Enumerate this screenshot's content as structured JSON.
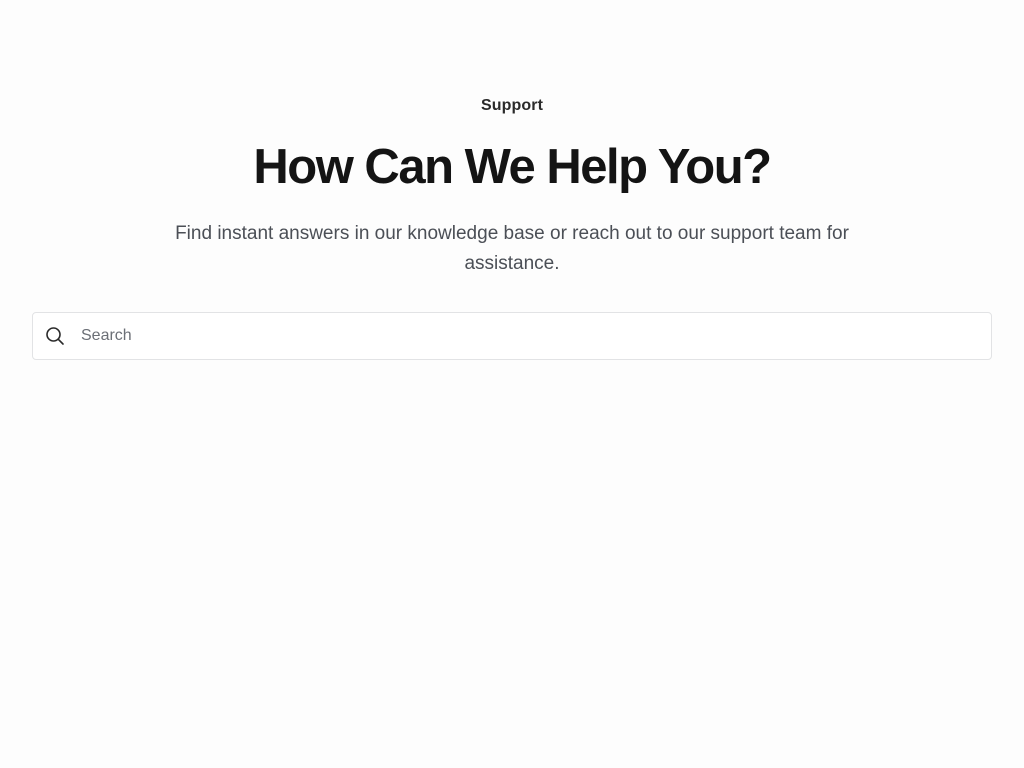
{
  "header": {
    "eyebrow": "Support",
    "title": "How Can We Help You?",
    "subtitle": "Find instant answers in our knowledge base or reach out to our support team for assistance."
  },
  "search": {
    "icon": "search-icon",
    "placeholder": "Search",
    "value": ""
  },
  "colors": {
    "background": "#fdfdfd",
    "title": "#141414",
    "body_text": "#4b4f56",
    "border": "#e2e3e5"
  }
}
